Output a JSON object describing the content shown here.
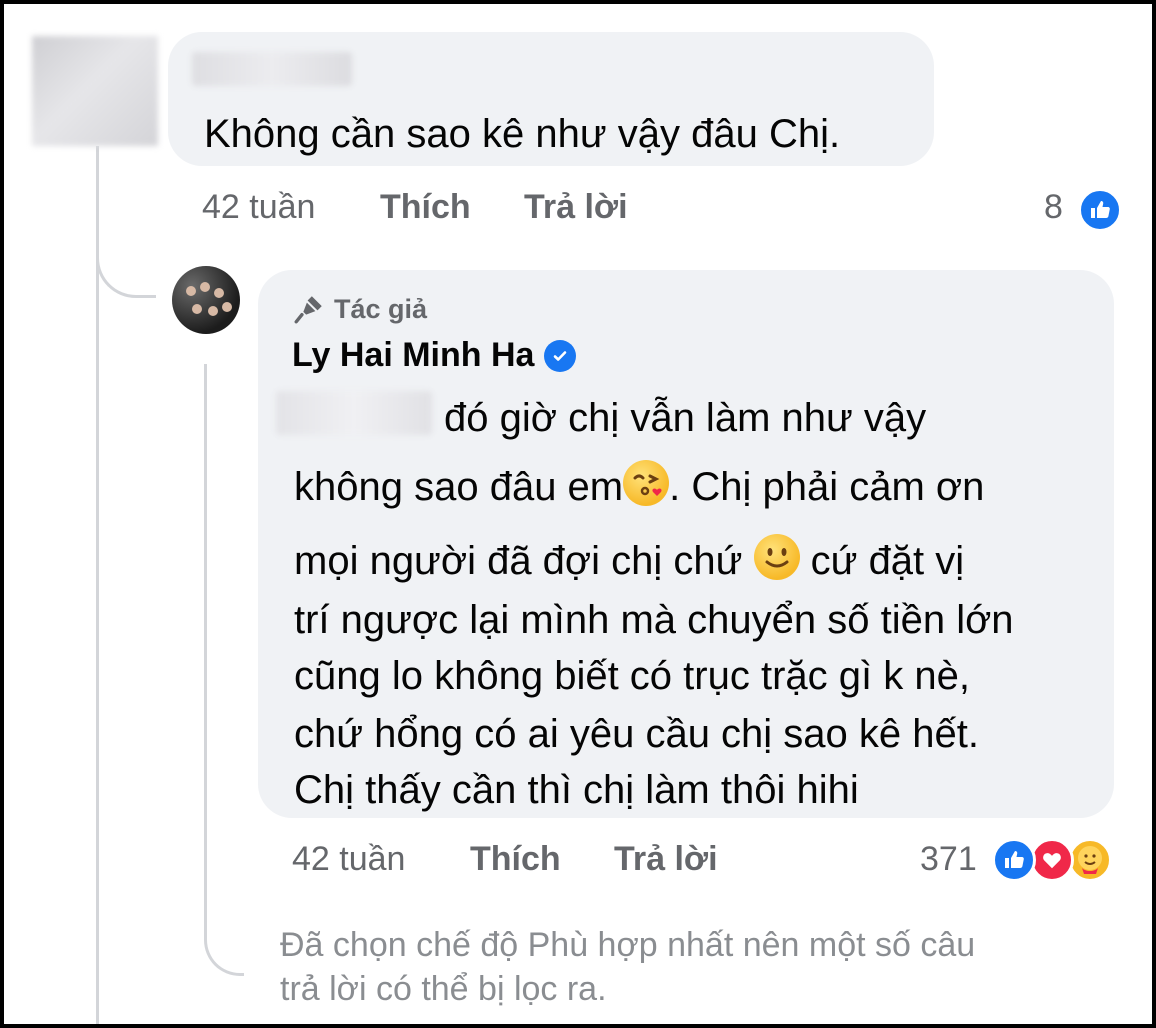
{
  "first_comment": {
    "text": "Không cần sao kê như vậy đâu Chị.",
    "time": "42 tuần",
    "like_label": "Thích",
    "reply_label": "Trả lời",
    "reaction_count": "8",
    "reaction_icons": [
      "like-icon"
    ]
  },
  "reply": {
    "badge_label": "Tác giả",
    "author_name": "Ly Hai Minh Ha",
    "verified": true,
    "lines": [
      "đó giờ chị vẫn làm như vậy",
      "không sao đâu em",
      ". Chị phải cảm ơn",
      "mọi người đã đợi chị chứ",
      "cứ đặt vị",
      "trí ngược lại mình mà chuyển số tiền lớn",
      "cũng lo không biết có trục trặc gì k nè,",
      "chứ hổng có ai yêu cầu chị sao kê hết.",
      "Chị thấy cần thì chị làm thôi hihi"
    ],
    "time": "42 tuần",
    "like_label": "Thích",
    "reply_label": "Trả lời",
    "reaction_count": "371",
    "reaction_icons": [
      "like-icon",
      "love-icon",
      "care-icon"
    ]
  },
  "filter_notice": {
    "line1": "Đã chọn chế độ Phù hợp nhất nên một số câu",
    "line2": "trả lời có thể bị lọc ra."
  },
  "colors": {
    "bubble": "#f0f2f5",
    "meta_text": "#65676b",
    "primary_text": "#050505",
    "like_blue": "#1877f2",
    "love_red": "#f02849"
  }
}
